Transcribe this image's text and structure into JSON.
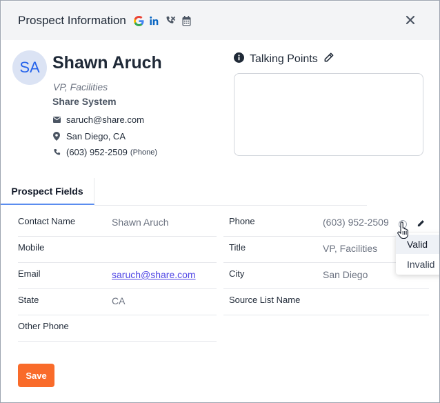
{
  "header": {
    "title": "Prospect Information",
    "icons": [
      "google-icon",
      "linkedin-icon",
      "phone-off-icon",
      "calendar-icon",
      "close-icon"
    ]
  },
  "profile": {
    "initials": "SA",
    "name": "Shawn Aruch",
    "role": "VP, Facilities",
    "company": "Share System",
    "email": "saruch@share.com",
    "location": "San Diego, CA",
    "phone": "(603) 952-2509",
    "phone_type": "(Phone)"
  },
  "talking_points": {
    "title": "Talking Points",
    "content": ""
  },
  "tabs": [
    {
      "label": "Prospect Fields",
      "active": true
    }
  ],
  "fields": {
    "left": [
      {
        "label": "Contact Name",
        "value": "Shawn Aruch"
      },
      {
        "label": "Mobile",
        "value": ""
      },
      {
        "label": "Email",
        "value": "saruch@share.com"
      },
      {
        "label": "State",
        "value": "CA"
      },
      {
        "label": "Other Phone",
        "value": ""
      }
    ],
    "right": [
      {
        "label": "Phone",
        "value": "(603) 952-2509"
      },
      {
        "label": "Title",
        "value": "VP, Facilities"
      },
      {
        "label": "City",
        "value": "San Diego"
      },
      {
        "label": "Source List Name",
        "value": ""
      }
    ]
  },
  "phone_status_menu": {
    "options": [
      "Valid",
      "Invalid"
    ],
    "highlighted": "Valid"
  },
  "actions": {
    "save_label": "Save"
  },
  "colors": {
    "accent": "#f96b2a",
    "avatar_bg": "#dbe3f4",
    "avatar_text": "#2563eb",
    "tab_underline": "#5b8def",
    "link": "#4f46e5"
  }
}
